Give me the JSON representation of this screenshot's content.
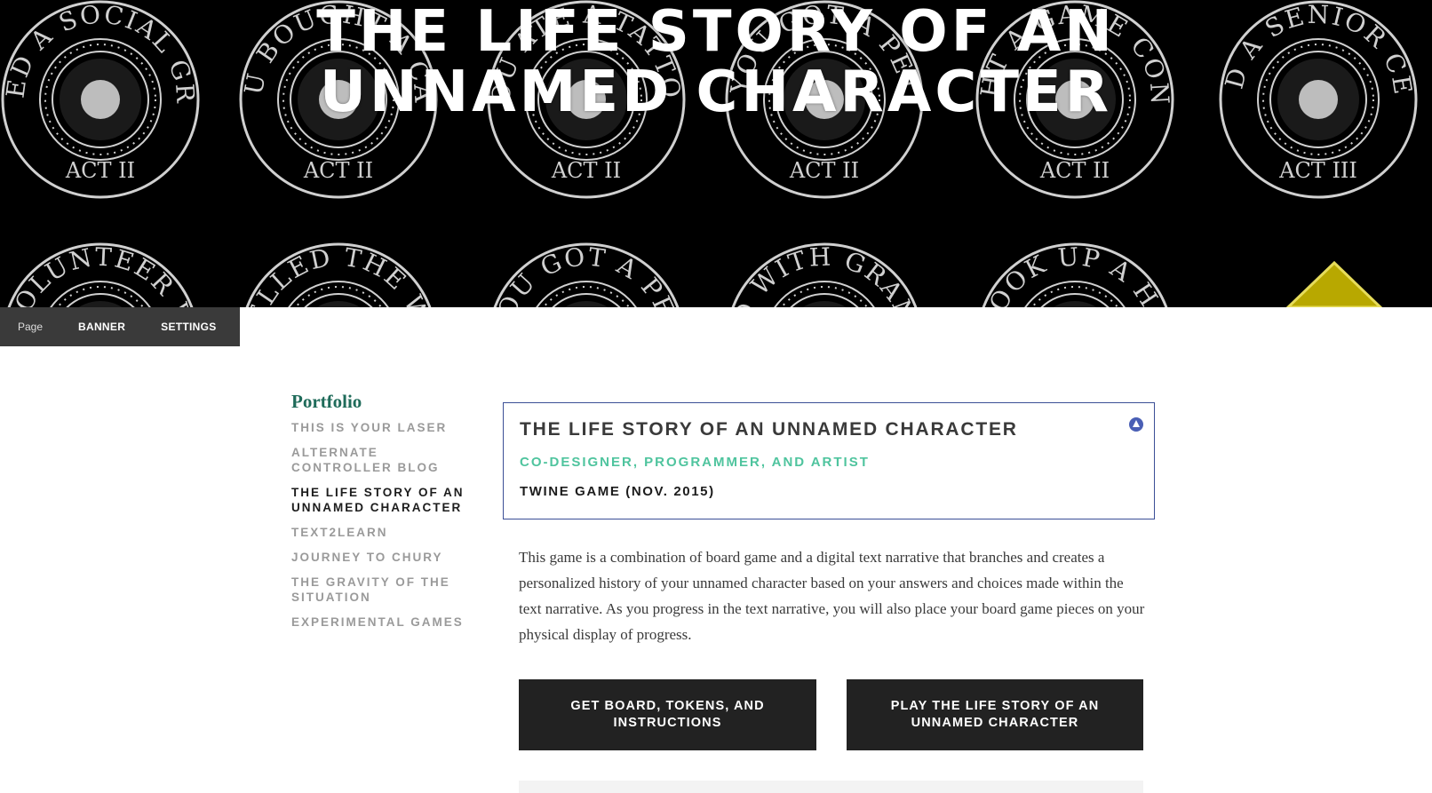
{
  "banner": {
    "title_line1": "THE LIFE STORY OF AN",
    "title_line2": "UNNAMED CHARACTER",
    "badges_top": [
      {
        "text": "JOINED A SOCIAL GROUP",
        "act": "ACT II",
        "icon": "people-icon"
      },
      {
        "text": "YOU BOUGHT A CAR!",
        "act": "ACT II",
        "icon": "car-icon"
      },
      {
        "text": "YOU ATE A TATTOO",
        "act": "ACT II",
        "icon": "heart-arrow-icon"
      },
      {
        "text": "YOU GOT A PET",
        "act": "ACT II",
        "icon": "pet-icon"
      },
      {
        "text": "BOUGHT A GAME CONSOLE",
        "act": "ACT II",
        "icon": "console-icon"
      },
      {
        "text": "JOINED A SENIOR CENTER",
        "act": "ACT III",
        "icon": "people-icon"
      }
    ],
    "badges_bottom": [
      {
        "text": "VOLUNTEER W"
      },
      {
        "text": "ELLED THE W"
      },
      {
        "text": "YOU GOT A PET"
      },
      {
        "text": "D WITH GRAN"
      },
      {
        "text": "TOOK UP A HO"
      }
    ]
  },
  "toolbar": {
    "page_label": "Page",
    "banner_label": "BANNER",
    "settings_label": "SETTINGS"
  },
  "sidebar": {
    "heading": "Portfolio",
    "items": [
      {
        "label": "THIS IS YOUR LASER",
        "active": false
      },
      {
        "label": "ALTERNATE CONTROLLER BLOG",
        "active": false
      },
      {
        "label": "THE LIFE STORY OF AN UNNAMED CHARACTER",
        "active": true
      },
      {
        "label": "TEXT2LEARN",
        "active": false
      },
      {
        "label": "JOURNEY TO CHURY",
        "active": false
      },
      {
        "label": "THE GRAVITY OF THE SITUATION",
        "active": false
      },
      {
        "label": "EXPERIMENTAL GAMES",
        "active": false
      }
    ]
  },
  "card": {
    "title": "THE LIFE STORY OF AN UNNAMED CHARACTER",
    "role": "CO-DESIGNER, PROGRAMMER, AND ARTIST",
    "subtitle": "TWINE GAME (NOV. 2015)"
  },
  "description": "This game is a combination of board game and a digital text narrative that branches and creates a personalized history of your unnamed character based on your answers and choices made within the text narrative. As you progress in the text narrative, you will also place your board game pieces on your physical display of progress.",
  "buttons": {
    "download_label": "GET BOARD, TOKENS, AND INSTRUCTIONS",
    "play_label": "PLAY THE LIFE STORY OF AN UNNAMED CHARACTER"
  },
  "colors": {
    "accent_teal": "#4fc49e",
    "heading_green": "#1f6b5a",
    "card_border": "#3b4f96",
    "button_bg": "#222222",
    "badge_gold": "#b8a800"
  }
}
